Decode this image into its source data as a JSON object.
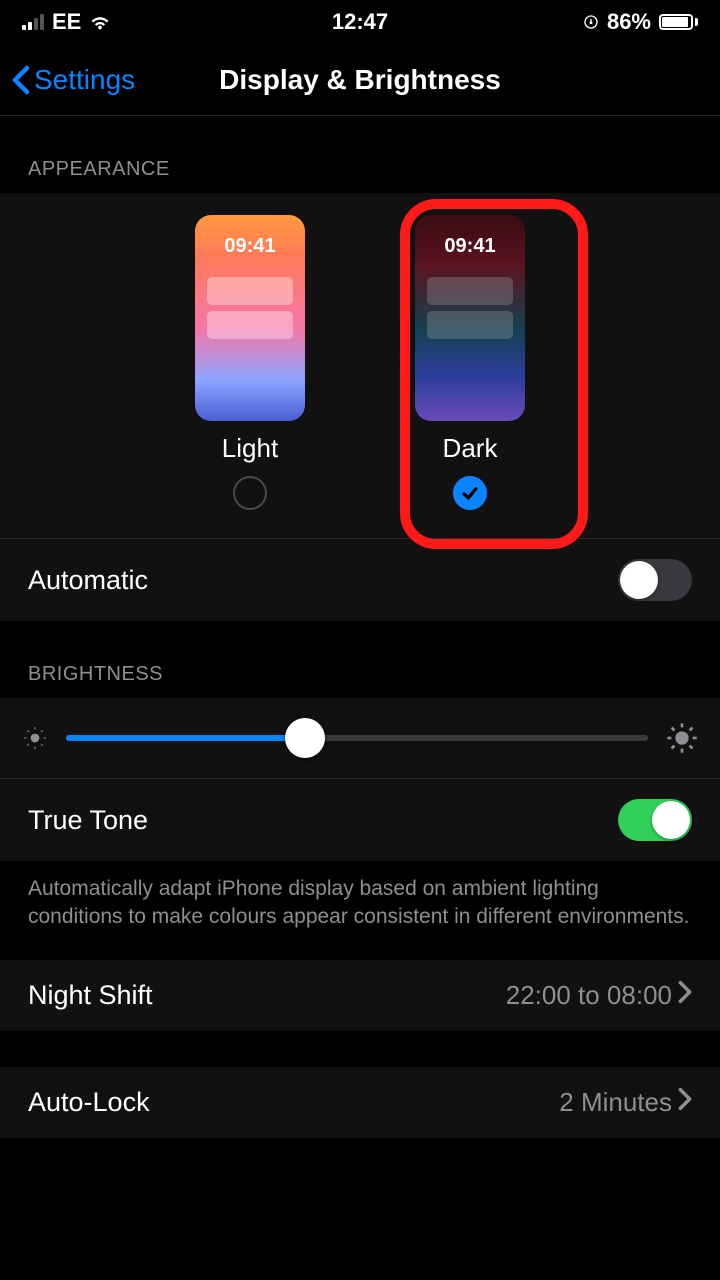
{
  "statusBar": {
    "carrier": "EE",
    "time": "12:47",
    "batteryPercent": "86%"
  },
  "nav": {
    "back": "Settings",
    "title": "Display & Brightness"
  },
  "appearance": {
    "header": "APPEARANCE",
    "previewTime": "09:41",
    "lightLabel": "Light",
    "darkLabel": "Dark",
    "selected": "dark",
    "automaticLabel": "Automatic"
  },
  "brightness": {
    "header": "BRIGHTNESS",
    "trueToneLabel": "True Tone",
    "trueToneDescription": "Automatically adapt iPhone display based on ambient lighting conditions to make colours appear consistent in different environments."
  },
  "nightShift": {
    "label": "Night Shift",
    "value": "22:00 to 08:00"
  },
  "autoLock": {
    "label": "Auto-Lock",
    "value": "2 Minutes"
  }
}
